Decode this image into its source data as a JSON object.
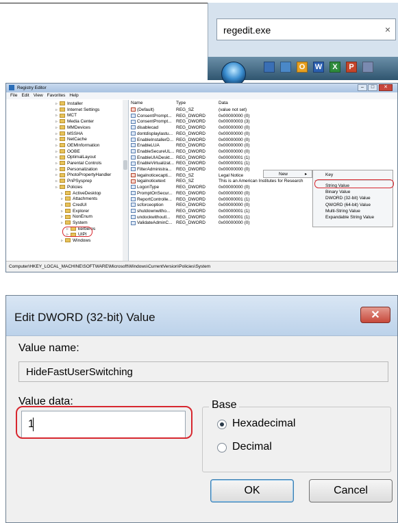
{
  "start_search": {
    "value": "regedit.exe",
    "clear_glyph": "×"
  },
  "taskbar": {
    "icons": [
      {
        "name": "monitor-icon",
        "glyph": "",
        "color": "#3a6fb5"
      },
      {
        "name": "folder-window-icon",
        "glyph": "",
        "color": "#4a88c8"
      },
      {
        "name": "outlook-icon",
        "glyph": "O",
        "color": "#e8a020"
      },
      {
        "name": "word-icon",
        "glyph": "W",
        "color": "#2b5fb0"
      },
      {
        "name": "excel-icon",
        "glyph": "X",
        "color": "#2e8b3c"
      },
      {
        "name": "powerpoint-icon",
        "glyph": "P",
        "color": "#c5452a"
      },
      {
        "name": "notepad-icon",
        "glyph": "",
        "color": "#7a8ab0"
      }
    ]
  },
  "regedit": {
    "title": "Registry Editor",
    "menu": [
      "File",
      "Edit",
      "View",
      "Favorites",
      "Help"
    ],
    "tree": [
      {
        "label": "Installer",
        "indent": 0
      },
      {
        "label": "Internet Settings",
        "indent": 0
      },
      {
        "label": "MCT",
        "indent": 0
      },
      {
        "label": "Media Center",
        "indent": 0
      },
      {
        "label": "MMDevices",
        "indent": 0
      },
      {
        "label": "MSSHA",
        "indent": 0
      },
      {
        "label": "NetCache",
        "indent": 0
      },
      {
        "label": "OEMInformation",
        "indent": 0
      },
      {
        "label": "OOBE",
        "indent": 0
      },
      {
        "label": "OptimalLayout",
        "indent": 0
      },
      {
        "label": "Parental Controls",
        "indent": 0
      },
      {
        "label": "Personalization",
        "indent": 0
      },
      {
        "label": "PhotoPropertyHandler",
        "indent": 0
      },
      {
        "label": "PnPSysprep",
        "indent": 0
      },
      {
        "label": "Policies",
        "indent": 0
      },
      {
        "label": "ActiveDesktop",
        "indent": 1
      },
      {
        "label": "Attachments",
        "indent": 1
      },
      {
        "label": "CredUI",
        "indent": 1
      },
      {
        "label": "Explorer",
        "indent": 1
      },
      {
        "label": "NonEnum",
        "indent": 1
      },
      {
        "label": "System",
        "indent": 1
      },
      {
        "label": "kerberos",
        "indent": 2
      },
      {
        "label": "UIPI",
        "indent": 2
      },
      {
        "label": "Windows",
        "indent": 1
      }
    ],
    "columns": [
      "Name",
      "Type",
      "Data"
    ],
    "values": [
      {
        "name": "(Default)",
        "type": "REG_SZ",
        "data": "(value not set)",
        "kind": "sz"
      },
      {
        "name": "ConsentPrompt...",
        "type": "REG_DWORD",
        "data": "0x00000000 (0)",
        "kind": "dw"
      },
      {
        "name": "ConsentPrompt...",
        "type": "REG_DWORD",
        "data": "0x00000003 (3)",
        "kind": "dw"
      },
      {
        "name": "disablecad",
        "type": "REG_DWORD",
        "data": "0x00000000 (0)",
        "kind": "dw"
      },
      {
        "name": "dontdisplaylastu...",
        "type": "REG_DWORD",
        "data": "0x00000000 (0)",
        "kind": "dw"
      },
      {
        "name": "EnableInstallerD...",
        "type": "REG_DWORD",
        "data": "0x00000000 (0)",
        "kind": "dw"
      },
      {
        "name": "EnableLUA",
        "type": "REG_DWORD",
        "data": "0x00000000 (0)",
        "kind": "dw"
      },
      {
        "name": "EnableSecureUL...",
        "type": "REG_DWORD",
        "data": "0x00000000 (0)",
        "kind": "dw"
      },
      {
        "name": "EnableUIADeskt...",
        "type": "REG_DWORD",
        "data": "0x00000001 (1)",
        "kind": "dw"
      },
      {
        "name": "EnableVirtualizat...",
        "type": "REG_DWORD",
        "data": "0x00000001 (1)",
        "kind": "dw"
      },
      {
        "name": "FilterAdministra...",
        "type": "REG_DWORD",
        "data": "0x00000000 (0)",
        "kind": "dw"
      },
      {
        "name": "legalnoticecapti...",
        "type": "REG_SZ",
        "data": "Legal Notice",
        "kind": "sz"
      },
      {
        "name": "legalnoticetext",
        "type": "REG_SZ",
        "data": "This is an American Institutes for Research",
        "kind": "sz"
      },
      {
        "name": "LogonType",
        "type": "REG_DWORD",
        "data": "0x00000000 (0)",
        "kind": "dw"
      },
      {
        "name": "PromptOnSecur...",
        "type": "REG_DWORD",
        "data": "0x00000000 (0)",
        "kind": "dw"
      },
      {
        "name": "ReportControlle...",
        "type": "REG_DWORD",
        "data": "0x00000001 (1)",
        "kind": "dw"
      },
      {
        "name": "scforceoption",
        "type": "REG_DWORD",
        "data": "0x00000000 (0)",
        "kind": "dw"
      },
      {
        "name": "shutdownwitho...",
        "type": "REG_DWORD",
        "data": "0x00000001 (1)",
        "kind": "dw"
      },
      {
        "name": "undockwithoutl...",
        "type": "REG_DWORD",
        "data": "0x00000001 (1)",
        "kind": "dw"
      },
      {
        "name": "ValidateAdminC...",
        "type": "REG_DWORD",
        "data": "0x00000000 (0)",
        "kind": "dw"
      }
    ],
    "context_menu": {
      "new_label": "New",
      "submenu": [
        "Key",
        "String Value",
        "Binary Value",
        "DWORD (32-bit) Value",
        "QWORD (64-bit) Value",
        "Multi-String Value",
        "Expandable String Value"
      ]
    },
    "status_path": "Computer\\HKEY_LOCAL_MACHINE\\SOFTWARE\\Microsoft\\Windows\\CurrentVersion\\Policies\\System",
    "highlight_color": "#d7262e"
  },
  "dialog": {
    "title": "Edit DWORD (32-bit) Value",
    "close_glyph": "✕",
    "value_name_label": "Value name:",
    "value_name": "HideFastUserSwitching",
    "value_data_label": "Value data:",
    "value_data": "1",
    "base_label": "Base",
    "base_options": [
      "Hexadecimal",
      "Decimal"
    ],
    "base_selected": "Hexadecimal",
    "ok_label": "OK",
    "cancel_label": "Cancel"
  }
}
